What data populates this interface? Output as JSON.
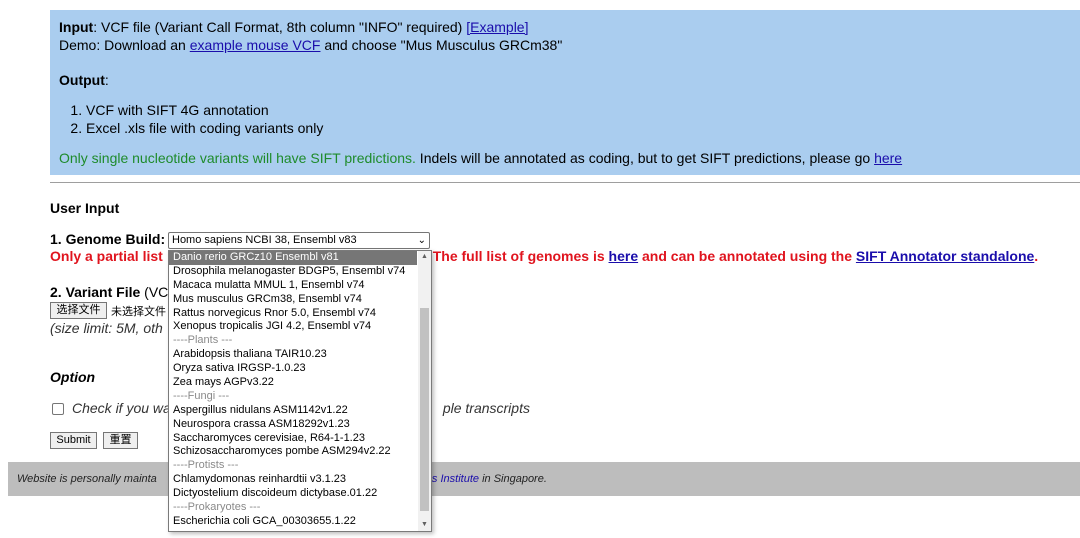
{
  "info": {
    "input_label": "Input",
    "input_text": ": VCF file (Variant Call Format, 8th column \"INFO\" required) ",
    "input_link": "[Example]",
    "demo_text": "Demo: Download an ",
    "demo_link": "example mouse VCF",
    "demo_suffix": " and choose \"Mus Musculus GRCm38\"",
    "output_label": "Output",
    "output_colon": ":",
    "output_items": [
      "VCF with SIFT 4G annotation",
      "Excel .xls file with coding variants only"
    ],
    "note_green": "Only single nucleotide variants will have SIFT predictions.",
    "note_plain": " Indels will be annotated as coding, but to get SIFT predictions, please go ",
    "note_link": "here"
  },
  "form": {
    "user_input": "User Input",
    "genome_label": "1. Genome Build:",
    "genome_selected": "Homo sapiens NCBI 38, Ensembl v83",
    "warning_prefix": "Only a partial list",
    "warning_suffix": "age. The full list of genomes is ",
    "warning_link1": "here",
    "warning_mid": " and can be annotated using the ",
    "warning_link2": "SIFT Annotator standalone",
    "warning_end": ".",
    "variant_label": "2. Variant File",
    "variant_paren": " (VC",
    "choose_file": "选择文件",
    "no_file": "未选择文件",
    "size_limit": "(size limit: 5M, oth",
    "option_label": "Option",
    "check_prefix": "Check if you wa",
    "check_suffix": "ple transcripts",
    "submit": "Submit",
    "reset": "重置"
  },
  "footer": {
    "prefix": "Website is personally mainta",
    "link": "atics Institute",
    "suffix": " in Singapore."
  },
  "dropdown": {
    "options": [
      {
        "label": "Danio rerio GRCz10 Ensembl v81",
        "kind": "selected"
      },
      {
        "label": "Drosophila melanogaster BDGP5, Ensembl v74",
        "kind": "item"
      },
      {
        "label": "Macaca mulatta MMUL 1, Ensembl v74",
        "kind": "item"
      },
      {
        "label": "Mus musculus GRCm38, Ensembl v74",
        "kind": "item"
      },
      {
        "label": "Rattus norvegicus Rnor 5.0, Ensembl v74",
        "kind": "item"
      },
      {
        "label": "Xenopus tropicalis JGI 4.2, Ensembl v74",
        "kind": "item"
      },
      {
        "label": "----Plants ---",
        "kind": "group"
      },
      {
        "label": "Arabidopsis thaliana TAIR10.23",
        "kind": "item"
      },
      {
        "label": "Oryza sativa IRGSP-1.0.23",
        "kind": "item"
      },
      {
        "label": "Zea mays AGPv3.22",
        "kind": "item"
      },
      {
        "label": "----Fungi ---",
        "kind": "group"
      },
      {
        "label": "Aspergillus nidulans ASM1142v1.22",
        "kind": "item"
      },
      {
        "label": "Neurospora crassa ASM18292v1.23",
        "kind": "item"
      },
      {
        "label": "Saccharomyces cerevisiae, R64-1-1.23",
        "kind": "item"
      },
      {
        "label": "Schizosaccharomyces pombe ASM294v2.22",
        "kind": "item"
      },
      {
        "label": "----Protists ---",
        "kind": "group"
      },
      {
        "label": "Chlamydomonas reinhardtii v3.1.23",
        "kind": "item"
      },
      {
        "label": "Dictyostelium discoideum dictybase.01.22",
        "kind": "item"
      },
      {
        "label": "----Prokaryotes ---",
        "kind": "group"
      },
      {
        "label": "Escherichia coli GCA_00303655.1.22",
        "kind": "item"
      }
    ]
  }
}
